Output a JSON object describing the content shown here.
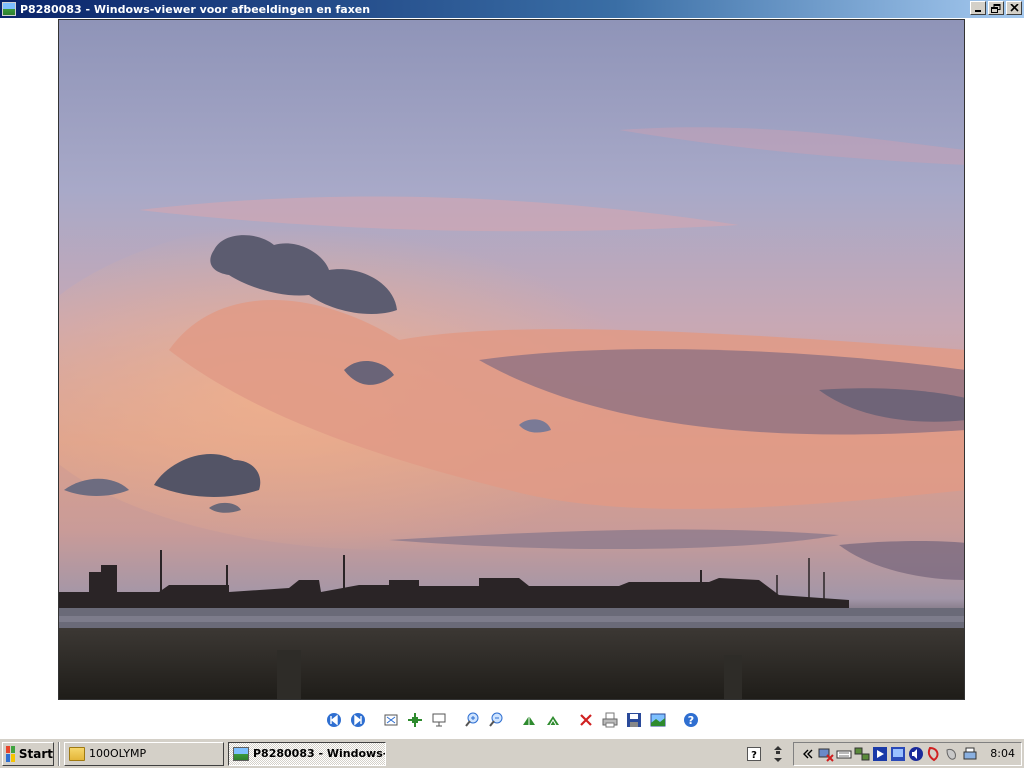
{
  "window": {
    "title": "P8280083 - Windows-viewer voor afbeeldingen en faxen",
    "buttons": [
      "minimize",
      "restore",
      "close"
    ]
  },
  "toolbar": {
    "buttons": [
      {
        "icon": "previous-image-icon"
      },
      {
        "icon": "next-image-icon"
      },
      {
        "icon": "best-fit-icon"
      },
      {
        "icon": "actual-size-icon"
      },
      {
        "icon": "slideshow-icon"
      },
      {
        "icon": "zoom-in-icon"
      },
      {
        "icon": "zoom-out-icon"
      },
      {
        "icon": "rotate-clockwise-icon"
      },
      {
        "icon": "rotate-counterclockwise-icon"
      },
      {
        "icon": "delete-icon"
      },
      {
        "icon": "print-icon"
      },
      {
        "icon": "save-icon"
      },
      {
        "icon": "open-editor-icon"
      },
      {
        "icon": "help-icon"
      }
    ]
  },
  "taskbar": {
    "start_label": "Start",
    "tasks": [
      {
        "label": "100OLYMP",
        "icon": "folder-icon",
        "active": false
      },
      {
        "label": "P8280083 - Windows-...",
        "icon": "image-viewer-icon",
        "active": true
      }
    ],
    "quick_icons": [
      "help-icon",
      "network-arrows-icon"
    ],
    "tray_icons": [
      "chevron-left-icon",
      "network-disconnected-icon",
      "keyboard-icon",
      "network-icon",
      "media-player-icon",
      "monitor-icon",
      "speaker-icon",
      "antivirus-icon",
      "audio-icon",
      "printer-icon"
    ],
    "clock": "8:04"
  },
  "colors": {
    "titlebar_start": "#0a246a",
    "titlebar_end": "#a6caf0",
    "taskbar": "#d4d0c8"
  }
}
